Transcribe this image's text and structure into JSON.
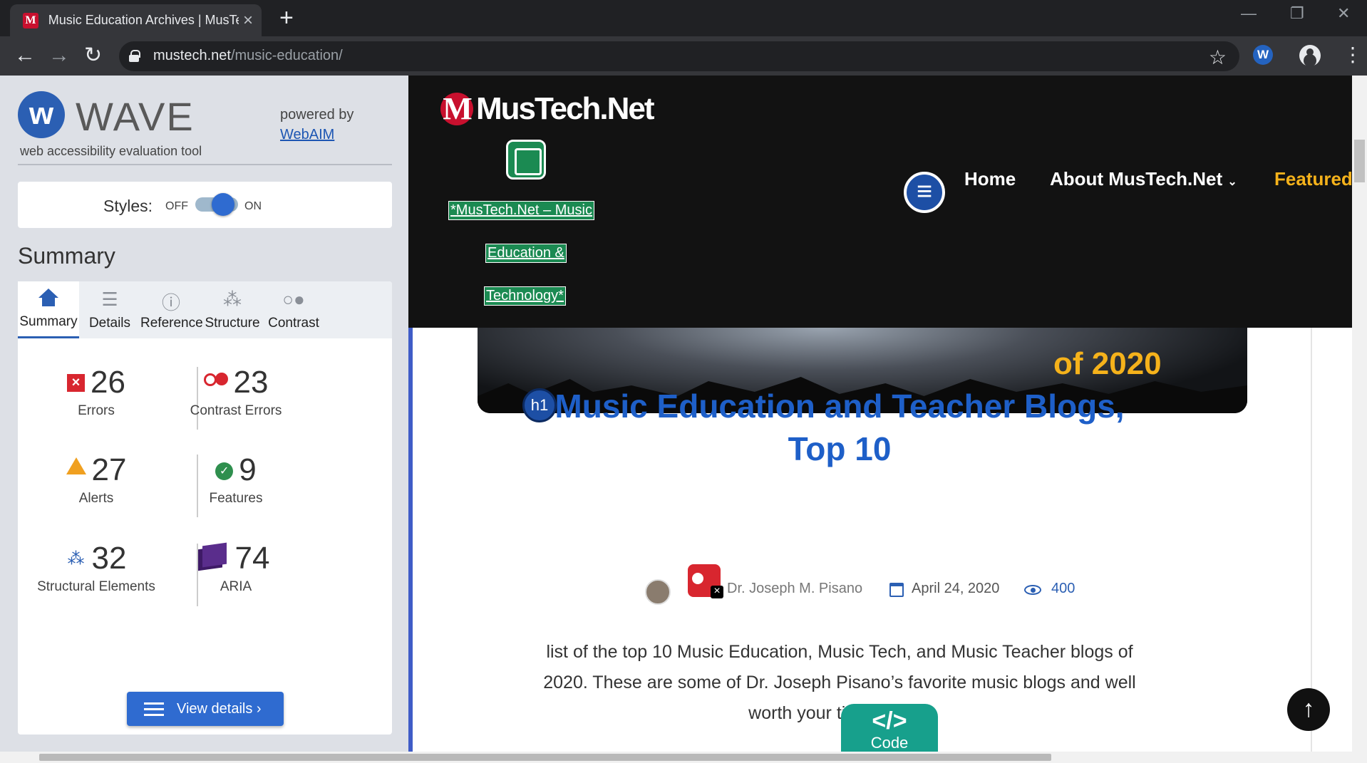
{
  "browser": {
    "tab_title": "Music Education Archives | MusTe",
    "url_host": "mustech.net",
    "url_path": "/music-education/",
    "new_tab": "+",
    "close_tab": "×",
    "star": "☆",
    "extension_letter": "W"
  },
  "wave": {
    "brand": "WAVE",
    "tagline": "web accessibility evaluation tool",
    "powered_by": "powered by",
    "webaim": "WebAIM",
    "styles_label": "Styles:",
    "off": "OFF",
    "on": "ON",
    "summary_heading": "Summary",
    "tabs": [
      {
        "label": "Summary",
        "icon": "home-icon"
      },
      {
        "label": "Details",
        "icon": "list-icon"
      },
      {
        "label": "Reference",
        "icon": "info-icon"
      },
      {
        "label": "Structure",
        "icon": "hierarchy-icon"
      },
      {
        "label": "Contrast",
        "icon": "contrast-icon"
      }
    ],
    "stats": {
      "errors": {
        "count": "26",
        "label": "Errors"
      },
      "contrast": {
        "count": "23",
        "label": "Contrast Errors"
      },
      "alerts": {
        "count": "27",
        "label": "Alerts"
      },
      "features": {
        "count": "9",
        "label": "Features"
      },
      "structural": {
        "count": "32",
        "label": "Structural Elements"
      },
      "aria": {
        "count": "74",
        "label": "ARIA"
      }
    },
    "view_details": "View details ›",
    "colors": {
      "accent": "#2b5fb3",
      "error": "#d8262f",
      "alert": "#f0a020",
      "feature": "#2f8f4e",
      "aria": "#5a2d8c"
    }
  },
  "site": {
    "logo_text": "MusTech.Net",
    "logo_alt_lines": [
      "*MusTech.Net – Music",
      "Education &",
      "Technology*"
    ],
    "nav": [
      "Home",
      "About MusTech.Net",
      "Featured"
    ],
    "hero_year": "of 2020",
    "h1_badge": "h1",
    "post_title": "Music Education and Teacher Blogs, Top 10",
    "author": "Dr. Joseph M. Pisano",
    "date": "April 24, 2020",
    "views": "400",
    "excerpt": "list of the top 10 Music Education, Music Tech, and Music Teacher blogs of 2020. These are some of Dr. Joseph Pisano’s favorite music blogs and well worth your time to visit.",
    "code_tag": "</>",
    "code_label": "Code",
    "back_to_top": "↑"
  }
}
